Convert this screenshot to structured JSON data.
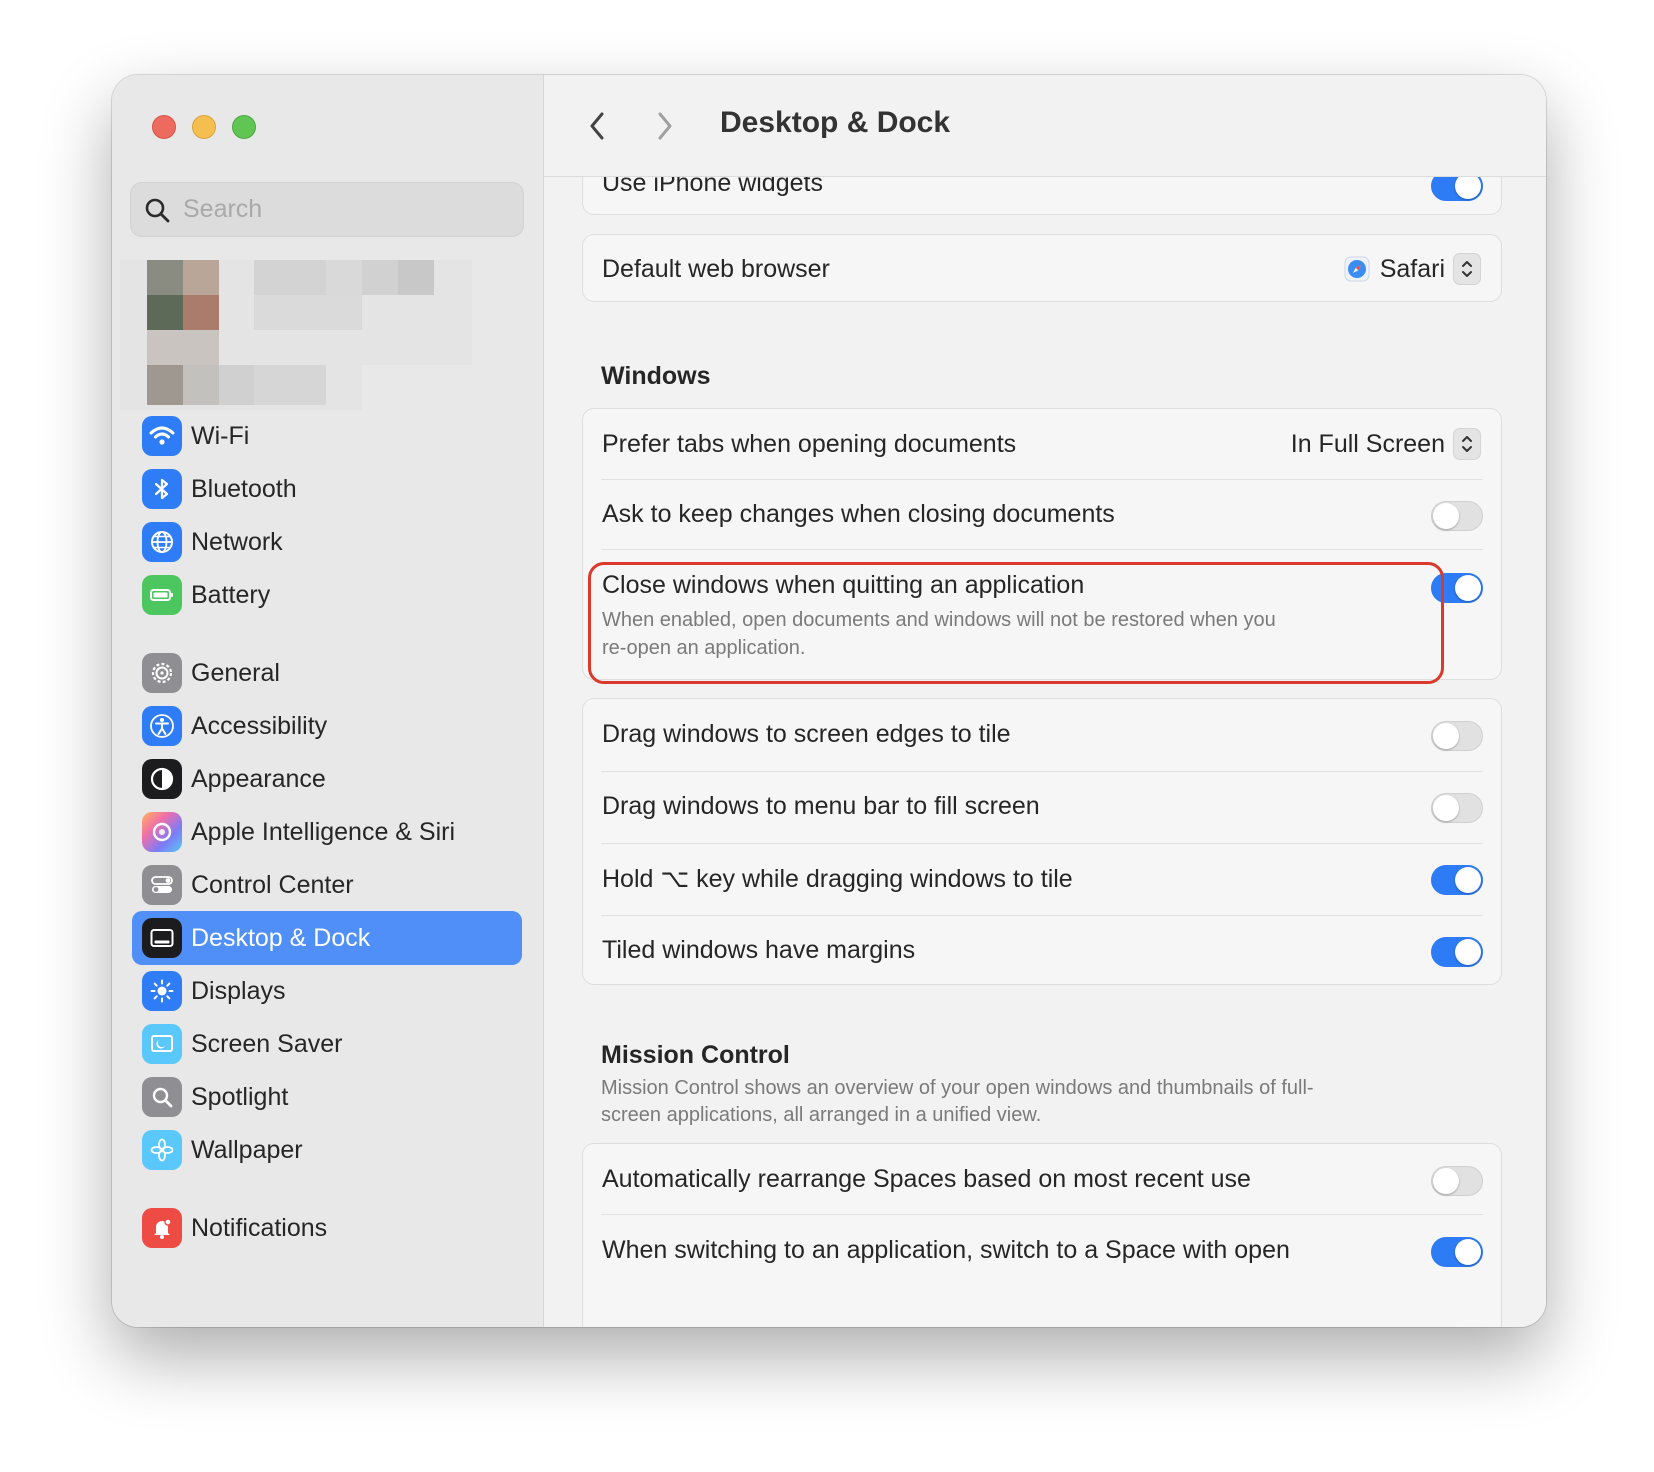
{
  "window": {
    "traffic_lights": {
      "close": "#ed6a5e",
      "minimize": "#f5bf4f",
      "zoom": "#61c554"
    }
  },
  "sidebar": {
    "search": {
      "placeholder": "Search",
      "value": ""
    },
    "items": [
      {
        "label": "Wi-Fi",
        "icon": "wifi-icon",
        "color": "#2f7df6"
      },
      {
        "label": "Bluetooth",
        "icon": "bluetooth-icon",
        "color": "#2f7df6"
      },
      {
        "label": "Network",
        "icon": "globe-icon",
        "color": "#2f7df6"
      },
      {
        "label": "Battery",
        "icon": "battery-icon",
        "color": "#4cc75f"
      },
      {
        "label": "General",
        "icon": "gear-icon",
        "color": "#8e8e93"
      },
      {
        "label": "Accessibility",
        "icon": "accessibility-icon",
        "color": "#2f7df6"
      },
      {
        "label": "Appearance",
        "icon": "appearance-icon",
        "color": "#1c1c1e"
      },
      {
        "label": "Apple Intelligence & Siri",
        "icon": "apple-intelligence-icon",
        "color": "#e97ad0"
      },
      {
        "label": "Control Center",
        "icon": "control-center-icon",
        "color": "#8e8e93"
      },
      {
        "label": "Desktop & Dock",
        "icon": "desktop-dock-icon",
        "color": "#1c1c1e",
        "selected": true
      },
      {
        "label": "Displays",
        "icon": "sun-icon",
        "color": "#2f7df6"
      },
      {
        "label": "Screen Saver",
        "icon": "screen-saver-icon",
        "color": "#5ac8fa"
      },
      {
        "label": "Spotlight",
        "icon": "magnifier-icon",
        "color": "#8e8e93"
      },
      {
        "label": "Wallpaper",
        "icon": "flower-icon",
        "color": "#5ac8fa"
      },
      {
        "label": "Notifications",
        "icon": "bell-icon",
        "color": "#ef4b45"
      }
    ],
    "selected_color": "#4f8ff7"
  },
  "header": {
    "back_icon": "chevron-left-icon",
    "forward_icon": "chevron-right-icon",
    "title": "Desktop & Dock"
  },
  "content": {
    "widgets_row": {
      "label": "Use iPhone widgets",
      "on": true
    },
    "browser_row": {
      "label": "Default web browser",
      "value": "Safari",
      "icon": "safari-icon"
    },
    "windows": {
      "title": "Windows",
      "prefer_tabs": {
        "label": "Prefer tabs when opening documents",
        "value": "In Full Screen"
      },
      "ask_keep": {
        "label": "Ask to keep changes when closing documents",
        "on": false
      },
      "close_windows": {
        "label": "Close windows when quitting an application",
        "description_line1": "When enabled, open documents and windows will not be restored when you",
        "description_line2": "re-open an application.",
        "on": true
      },
      "tiling": [
        {
          "label": "Drag windows to screen edges to tile",
          "on": false
        },
        {
          "label": "Drag windows to menu bar to fill screen",
          "on": false
        },
        {
          "label": "Hold ⌥ key while dragging windows to tile",
          "on": true
        },
        {
          "label": "Tiled windows have margins",
          "on": true
        }
      ]
    },
    "mission_control": {
      "title": "Mission Control",
      "description_line1": "Mission Control shows an overview of your open windows and thumbnails of full-",
      "description_line2": "screen applications, all arranged in a unified view.",
      "rows": [
        {
          "label": "Automatically rearrange Spaces based on most recent use",
          "on": false
        },
        {
          "label": "When switching to an application, switch to a Space with open",
          "on": true
        }
      ]
    },
    "toggle_on_color": "#2d7bf5",
    "highlight_color": "#d93a2b"
  }
}
